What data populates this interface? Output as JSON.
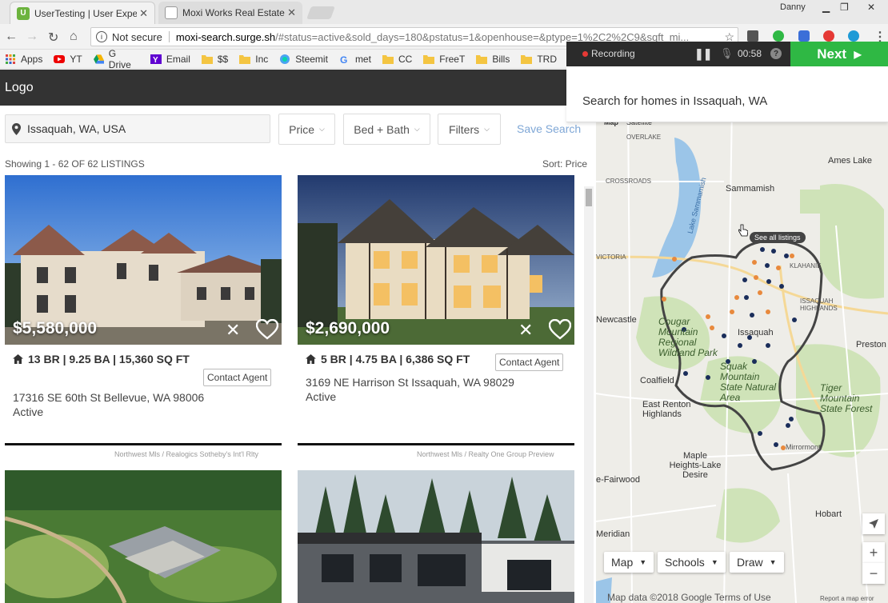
{
  "browser": {
    "tabs": [
      {
        "label": "UserTesting | User Experi",
        "active": true
      },
      {
        "label": "Moxi Works Real Estate S",
        "active": false
      }
    ],
    "user_name": "Danny",
    "security_label": "Not secure",
    "url_host": "moxi-search.surge.sh",
    "url_rest": "/#status=active&sold_days=180&pstatus=1&openhouse=&ptype=1%2C2%2C9&sqft_mi...",
    "bookmarks": [
      "Apps",
      "YT",
      "G Drive",
      "Email",
      "$$",
      "Inc",
      "Steemit",
      "met",
      "CC",
      "FreeT",
      "Bills",
      "TRD"
    ]
  },
  "recorder": {
    "recording_label": "Recording",
    "time": "00:58",
    "next_label": "Next",
    "task_text": "Search for homes in Issaquah, WA"
  },
  "app": {
    "logo": "Logo",
    "location": "Issaquah, WA, USA",
    "filters": {
      "price": "Price",
      "bed_bath": "Bed + Bath",
      "filters": "Filters"
    },
    "save_search": "Save Search",
    "showing": "Showing 1 - 62 OF 62 LISTINGS",
    "sort": "Sort: Price"
  },
  "listings": [
    {
      "price": "$5,580,000",
      "specs": "13 BR | 9.25 BA | 15,360 SQ FT",
      "contact": "Contact Agent",
      "address": "17316 SE 60th St Bellevue, WA 98006",
      "status": "Active",
      "broker": "Northwest Mls / Realogics Sotheby's Int'l Rlty"
    },
    {
      "price": "$2,690,000",
      "specs": "5 BR | 4.75 BA | 6,386 SQ FT",
      "contact": "Contact Agent",
      "address": "3169 NE Harrison St Issaquah, WA 98029",
      "status": "Active",
      "broker": "Northwest Mls / Realty One Group Preview"
    }
  ],
  "map": {
    "maptype_labels": [
      "Map",
      "Satellite"
    ],
    "see_all": "See all listings",
    "places": [
      "OVERLAKE",
      "Ames Lake",
      "CROSSROADS",
      "Sammamish",
      "Lake Sammamish",
      "VICTORIA",
      "KLAHANIE",
      "ISSAQUAH HIGHLANDS",
      "Newcastle",
      "Cougar Mountain Regional Wildland Park",
      "Issaquah",
      "Preston",
      "Coalfield",
      "Squak Mountain State Natural Area",
      "East Renton Highlands",
      "Tiger Mountain State Forest",
      "Hobart",
      "Maple Heights-Lake Desire",
      "e-Fairwood",
      "Mirrormont",
      "Meridian"
    ],
    "controls": {
      "map": "Map",
      "schools": "Schools",
      "draw": "Draw"
    },
    "footer": "Map data ©2018 Google   Terms of Use",
    "error_link": "Report a map error"
  },
  "colors": {
    "accent_blue": "#7fa7d6",
    "next_green": "#2fb844",
    "header_dark": "#333333",
    "pin_navy": "#1a2d5a",
    "pin_orange": "#e8893d"
  }
}
